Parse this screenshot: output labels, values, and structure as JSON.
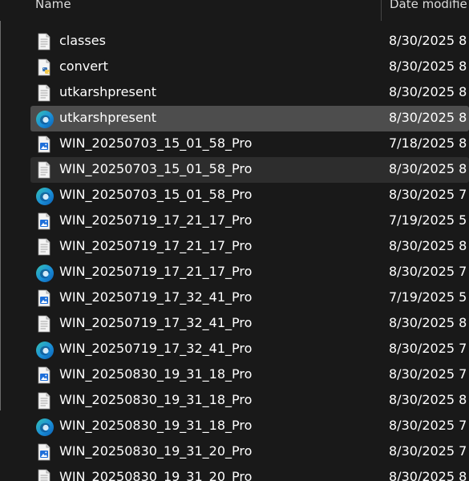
{
  "header": {
    "name_label": "Name",
    "date_label": "Date modifie"
  },
  "files": [
    {
      "name": "classes",
      "date": "8/30/2025 8",
      "icon": "text-file-icon"
    },
    {
      "name": "convert",
      "date": "8/30/2025 8",
      "icon": "python-file-icon"
    },
    {
      "name": "utkarshpresent",
      "date": "8/30/2025 8",
      "icon": "text-file-icon"
    },
    {
      "name": "utkarshpresent",
      "date": "8/30/2025 8",
      "icon": "edge-icon",
      "state": "selected"
    },
    {
      "name": "WIN_20250703_15_01_58_Pro",
      "date": "7/18/2025 8",
      "icon": "image-file-icon"
    },
    {
      "name": "WIN_20250703_15_01_58_Pro",
      "date": "8/30/2025 8",
      "icon": "text-file-icon",
      "state": "hover"
    },
    {
      "name": "WIN_20250703_15_01_58_Pro",
      "date": "8/30/2025 7",
      "icon": "edge-icon"
    },
    {
      "name": "WIN_20250719_17_21_17_Pro",
      "date": "7/19/2025 5",
      "icon": "image-file-icon"
    },
    {
      "name": "WIN_20250719_17_21_17_Pro",
      "date": "8/30/2025 8",
      "icon": "text-file-icon"
    },
    {
      "name": "WIN_20250719_17_21_17_Pro",
      "date": "8/30/2025 7",
      "icon": "edge-icon"
    },
    {
      "name": "WIN_20250719_17_32_41_Pro",
      "date": "7/19/2025 5",
      "icon": "image-file-icon"
    },
    {
      "name": "WIN_20250719_17_32_41_Pro",
      "date": "8/30/2025 8",
      "icon": "text-file-icon"
    },
    {
      "name": "WIN_20250719_17_32_41_Pro",
      "date": "8/30/2025 7",
      "icon": "edge-icon"
    },
    {
      "name": "WIN_20250830_19_31_18_Pro",
      "date": "8/30/2025 7",
      "icon": "image-file-icon"
    },
    {
      "name": "WIN_20250830_19_31_18_Pro",
      "date": "8/30/2025 8",
      "icon": "text-file-icon"
    },
    {
      "name": "WIN_20250830_19_31_18_Pro",
      "date": "8/30/2025 7",
      "icon": "edge-icon"
    },
    {
      "name": "WIN_20250830_19_31_20_Pro",
      "date": "8/30/2025 7",
      "icon": "image-file-icon"
    },
    {
      "name": "WIN_20250830_19_31_20_Pro",
      "date": "8/30/2025 8",
      "icon": "text-file-icon"
    }
  ]
}
